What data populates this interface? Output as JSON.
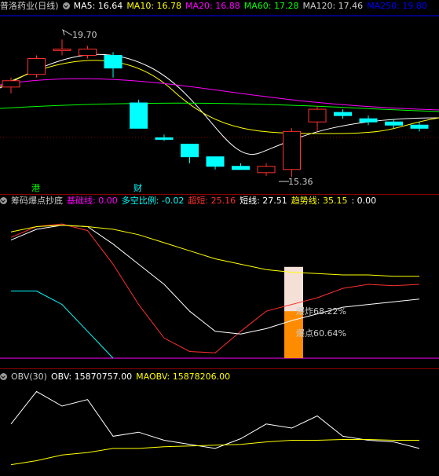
{
  "main": {
    "title": "普洛药业(日线)",
    "ma": [
      {
        "label": "MA5: 16.64",
        "color": "#ffffff"
      },
      {
        "label": "MA10: 16.78",
        "color": "#ffff00"
      },
      {
        "label": "MA20: 16.88",
        "color": "#ff00ff"
      },
      {
        "label": "MA60: 17.28",
        "color": "#00ff00"
      },
      {
        "label": "MA120: 17.46",
        "color": "#cccccc"
      },
      {
        "label": "MA250: 19.80",
        "color": "#0000ff"
      }
    ],
    "high_label": "19.70",
    "low_label": "15.36",
    "tag1": "港",
    "tag2": "财"
  },
  "ind2": {
    "title": "筹码爆点抄底",
    "items": [
      {
        "label": "基础线: 0.00",
        "color": "#ff00ff"
      },
      {
        "label": "多空比例: -0.02",
        "color": "#00ffff"
      },
      {
        "label": "超短: 25.16",
        "color": "#ff3030"
      },
      {
        "label": "短线: 27.51",
        "color": "#ffffff"
      },
      {
        "label": "趋势线: 35.15",
        "color": "#ffff00"
      },
      {
        "label": ": 0.00",
        "color": "#ffffff"
      }
    ],
    "label_explode": "爆炸68.22%",
    "label_point": "爆点60.64%"
  },
  "ind3": {
    "title": "OBV(30)",
    "items": [
      {
        "label": "OBV: 15870757.00",
        "color": "#ffffff"
      },
      {
        "label": "MAOBV: 15878206.00",
        "color": "#ffff00"
      }
    ]
  },
  "chart_data": [
    {
      "type": "candlestick",
      "title": "普洛药业(日线)",
      "candles": [
        {
          "o": 18.2,
          "c": 18.4,
          "h": 18.5,
          "l": 18.0,
          "up": true
        },
        {
          "o": 18.6,
          "c": 19.1,
          "h": 19.2,
          "l": 18.5,
          "up": true
        },
        {
          "o": 19.4,
          "c": 19.4,
          "h": 19.7,
          "l": 19.2,
          "up": true
        },
        {
          "o": 19.2,
          "c": 19.4,
          "h": 19.5,
          "l": 19.1,
          "up": true
        },
        {
          "o": 19.2,
          "c": 18.8,
          "h": 19.3,
          "l": 18.5,
          "up": false
        },
        {
          "o": 17.7,
          "c": 16.9,
          "h": 17.8,
          "l": 16.9,
          "up": false
        },
        {
          "o": 16.6,
          "c": 16.6,
          "h": 16.7,
          "l": 16.5,
          "up": false
        },
        {
          "o": 16.4,
          "c": 16.0,
          "h": 16.4,
          "l": 15.8,
          "up": false
        },
        {
          "o": 16.0,
          "c": 15.7,
          "h": 16.0,
          "l": 15.6,
          "up": false
        },
        {
          "o": 15.7,
          "c": 15.6,
          "h": 15.8,
          "l": 15.6,
          "up": false
        },
        {
          "o": 15.5,
          "c": 15.7,
          "h": 15.8,
          "l": 15.4,
          "up": true
        },
        {
          "o": 15.6,
          "c": 16.8,
          "h": 16.9,
          "l": 15.36,
          "up": true
        },
        {
          "o": 17.1,
          "c": 17.5,
          "h": 17.6,
          "l": 16.8,
          "up": true
        },
        {
          "o": 17.4,
          "c": 17.3,
          "h": 17.5,
          "l": 17.2,
          "up": false
        },
        {
          "o": 17.2,
          "c": 17.1,
          "h": 17.3,
          "l": 17.0,
          "up": false
        },
        {
          "o": 17.1,
          "c": 17.0,
          "h": 17.2,
          "l": 16.9,
          "up": false
        },
        {
          "o": 17.0,
          "c": 16.9,
          "h": 17.1,
          "l": 16.8,
          "up": false
        }
      ],
      "ylim": [
        15.0,
        20.5
      ]
    },
    {
      "type": "line",
      "title": "筹码爆点抄底",
      "series": [
        {
          "name": "超短",
          "color": "#ff3030",
          "values": [
            90,
            98,
            100,
            95,
            70,
            40,
            15,
            5,
            4,
            20,
            35,
            40,
            45,
            52,
            55,
            54,
            55
          ]
        },
        {
          "name": "短线",
          "color": "#ffffff",
          "values": [
            88,
            96,
            99,
            98,
            85,
            70,
            55,
            35,
            20,
            18,
            22,
            28,
            33,
            38,
            40,
            42,
            44
          ]
        },
        {
          "name": "趋势线",
          "color": "#ffff00",
          "values": [
            94,
            98,
            99,
            98,
            96,
            92,
            86,
            80,
            74,
            70,
            66,
            64,
            63,
            62,
            62,
            61,
            61
          ]
        },
        {
          "name": "多空比例",
          "color": "#00ffff",
          "values": [
            50,
            50,
            40,
            20,
            0
          ]
        }
      ],
      "ylim": [
        0,
        110
      ]
    },
    {
      "type": "line",
      "title": "OBV(30)",
      "series": [
        {
          "name": "OBV",
          "color": "#ffffff",
          "values": [
            60,
            100,
            82,
            90,
            45,
            50,
            40,
            35,
            30,
            42,
            60,
            55,
            70,
            45,
            40,
            38,
            30
          ]
        },
        {
          "name": "MAOBV",
          "color": "#ffff00",
          "values": [
            10,
            15,
            22,
            25,
            30,
            30,
            32,
            33,
            34,
            35,
            38,
            40,
            40,
            41,
            41,
            40,
            40
          ]
        }
      ],
      "ylim": [
        0,
        110
      ]
    }
  ]
}
